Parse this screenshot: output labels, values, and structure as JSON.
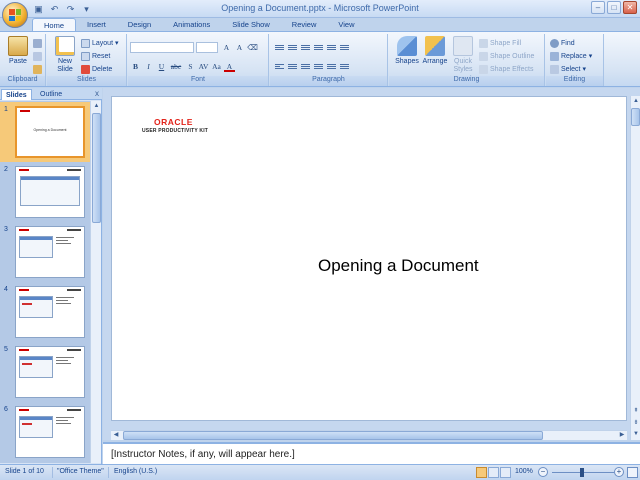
{
  "window": {
    "title": "Opening a Document.pptx - Microsoft PowerPoint",
    "controls": [
      "–",
      "□",
      "✕"
    ]
  },
  "quick_access": [
    "save-icon",
    "undo-icon",
    "redo-icon",
    "customize-icon"
  ],
  "ribbon": {
    "tabs": [
      "Home",
      "Insert",
      "Design",
      "Animations",
      "Slide Show",
      "Review",
      "View"
    ],
    "active_tab": "Home",
    "groups": {
      "clipboard": {
        "label": "Clipboard",
        "paste": "Paste"
      },
      "slides": {
        "label": "Slides",
        "new_slide": "New",
        "new_slide_2": "Slide",
        "layout": "Layout",
        "reset": "Reset",
        "delete": "Delete"
      },
      "font": {
        "label": "Font",
        "buttons": [
          "B",
          "I",
          "U",
          "abc",
          "S",
          "AV",
          "Aa",
          "A"
        ]
      },
      "paragraph": {
        "label": "Paragraph"
      },
      "drawing": {
        "label": "Drawing",
        "shapes": "Shapes",
        "arrange": "Arrange",
        "quick_styles": "Quick",
        "quick_styles_2": "Styles",
        "shape_fill": "Shape Fill",
        "shape_outline": "Shape Outline",
        "shape_effects": "Shape Effects"
      },
      "editing": {
        "label": "Editing",
        "find": "Find",
        "replace": "Replace",
        "select": "Select"
      }
    }
  },
  "left_pane": {
    "tabs": [
      "Slides",
      "Outline"
    ],
    "active_tab": "Slides",
    "close": "x",
    "thumbnails": [
      {
        "num": "1",
        "title": "Opening a Document",
        "selected": true
      },
      {
        "num": "2"
      },
      {
        "num": "3"
      },
      {
        "num": "4"
      },
      {
        "num": "5"
      },
      {
        "num": "6"
      }
    ]
  },
  "slide": {
    "logo_line1": "ORACLE",
    "logo_line2": "USER PRODUCTIVITY KIT",
    "title": "Opening a Document"
  },
  "notes": {
    "text": "[Instructor Notes, if any, will appear here.]"
  },
  "status": {
    "slide_info": "Slide 1 of 10",
    "theme": "\"Office Theme\"",
    "language": "English (U.S.)",
    "zoom": "100%"
  },
  "colors": {
    "accent": "#15428b",
    "ribbon_bg": "#d7e4f4",
    "selection": "#f6c979",
    "oracle_red": "#e2231a"
  }
}
